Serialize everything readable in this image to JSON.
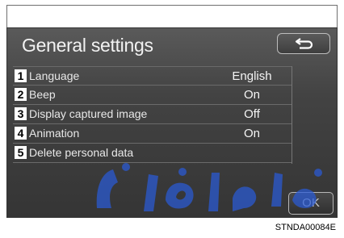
{
  "screen": {
    "title": "General settings",
    "back_icon": "return-arrow-icon"
  },
  "items": [
    {
      "number": "1",
      "label": "Language",
      "value": "English"
    },
    {
      "number": "2",
      "label": "Beep",
      "value": "On"
    },
    {
      "number": "3",
      "label": "Display captured image",
      "value": "Off"
    },
    {
      "number": "4",
      "label": "Animation",
      "value": "On"
    },
    {
      "number": "5",
      "label": "Delete personal data",
      "value": ""
    }
  ],
  "ok_label": "OK",
  "caption": "STNDA00084E",
  "watermark": {
    "text": "دی فارما",
    "color": "#2a5bd7"
  }
}
